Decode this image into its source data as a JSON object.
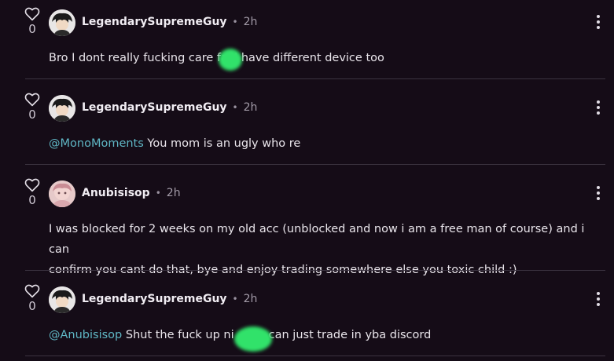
{
  "colors": {
    "background": "#150c17",
    "mention": "#5fb6c4",
    "censor_blob": "#31e26a",
    "divider": "#3b3340"
  },
  "comments": [
    {
      "votes": "0",
      "username": "LegendarySupremeGuy",
      "dot": "•",
      "time": "2h",
      "avatar": "black-haired-character-avatar",
      "text": "Bro I dont really fucking care fa    I have different device too",
      "text_parts": [
        "Bro I dont really fucking care fa",
        "I have different device too"
      ]
    },
    {
      "votes": "0",
      "username": "LegendarySupremeGuy",
      "dot": "•",
      "time": "2h",
      "avatar": "black-haired-character-avatar",
      "mention": "@MonoMoments",
      "text": " You mom is an ugly who re"
    },
    {
      "votes": "0",
      "username": "Anubisisop",
      "dot": "•",
      "time": "2h",
      "avatar": "pink-character-avatar",
      "text_lines": [
        "I was blocked for 2 weeks on my old acc (unblocked and now i am a free man of course) and i can",
        "confirm you cant do that, bye and enjoy trading somewhere else you toxic child :)"
      ]
    },
    {
      "votes": "0",
      "username": "LegendarySupremeGuy",
      "dot": "•",
      "time": "2h",
      "avatar": "black-haired-character-avatar",
      "mention": "@Anubisisop",
      "text_parts": [
        " Shut the fuck up ni",
        "can just trade in yba discord"
      ]
    }
  ]
}
